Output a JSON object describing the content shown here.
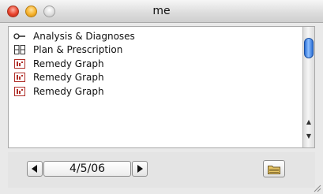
{
  "window": {
    "title": "me"
  },
  "list": {
    "items": [
      {
        "label": "Analysis & Diagnoses",
        "icon": "key-icon"
      },
      {
        "label": "Plan & Prescription",
        "icon": "grid-icon"
      },
      {
        "label": "Remedy Graph",
        "icon": "graph-icon"
      },
      {
        "label": "Remedy Graph",
        "icon": "graph-icon"
      },
      {
        "label": "Remedy Graph",
        "icon": "graph-icon"
      }
    ]
  },
  "footer": {
    "date": "4/5/06"
  },
  "colors": {
    "accent": "#2a6ed6",
    "graph_icon": "#b0302a"
  }
}
